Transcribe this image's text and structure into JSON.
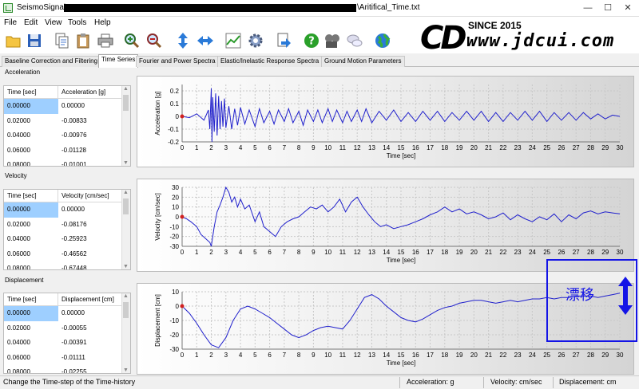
{
  "window": {
    "title": "SeismoSignal",
    "file_name": "\\Aritifical_Time.txt",
    "controls": [
      "—",
      "☐",
      "✕"
    ]
  },
  "menu": [
    "File",
    "Edit",
    "View",
    "Tools",
    "Help"
  ],
  "toolbar_icons": [
    "open-folder-icon",
    "save-icon",
    "copy-icon",
    "clipboard-icon",
    "print-icon",
    "zoom-in-icon",
    "zoom-out-icon",
    "vertical-arrows-icon",
    "horizontal-arrows-icon",
    "chart-icon",
    "gear-icon",
    "export-icon",
    "help-icon",
    "film-icon",
    "chat-icon",
    "globe-icon"
  ],
  "tabs": [
    {
      "label": "Baseline Correction and Filtering",
      "active": false
    },
    {
      "label": "Time Series",
      "active": true
    },
    {
      "label": "Fourier and Power Spectra",
      "active": false
    },
    {
      "label": "Elastic/Inelastic Response Spectra",
      "active": false
    },
    {
      "label": "Ground Motion Parameters",
      "active": false
    }
  ],
  "sections": [
    {
      "label": "Acceleration",
      "columns": [
        "Time [sec]",
        "Acceleration [g]"
      ],
      "rows": [
        [
          "0.00000",
          "0.00000"
        ],
        [
          "0.02000",
          "-0.00833"
        ],
        [
          "0.04000",
          "-0.00976"
        ],
        [
          "0.06000",
          "-0.01128"
        ],
        [
          "0.08000",
          "-0.01001"
        ]
      ]
    },
    {
      "label": "Velocity",
      "columns": [
        "Time [sec]",
        "Velocity [cm/sec]"
      ],
      "rows": [
        [
          "0.00000",
          "0.00000"
        ],
        [
          "0.02000",
          "-0.08176"
        ],
        [
          "0.04000",
          "-0.25923"
        ],
        [
          "0.06000",
          "-0.46562"
        ],
        [
          "0.08000",
          "-0.67448"
        ]
      ]
    },
    {
      "label": "Displacement",
      "columns": [
        "Time [sec]",
        "Displacement [cm]"
      ],
      "rows": [
        [
          "0.00000",
          "0.00000"
        ],
        [
          "0.02000",
          "-0.00055"
        ],
        [
          "0.04000",
          "-0.00391"
        ],
        [
          "0.06000",
          "-0.01111"
        ],
        [
          "0.08000",
          "-0.02255"
        ]
      ]
    }
  ],
  "chart_data": [
    {
      "type": "line",
      "xlabel": "Time [sec]",
      "ylabel": "Acceleration [g]",
      "xlim": [
        0,
        30
      ],
      "ylim": [
        -0.2,
        0.25
      ],
      "xticks": [
        0,
        1,
        2,
        3,
        4,
        5,
        6,
        7,
        8,
        9,
        10,
        11,
        12,
        13,
        14,
        15,
        16,
        17,
        18,
        19,
        20,
        21,
        22,
        23,
        24,
        25,
        26,
        27,
        28,
        29,
        30
      ],
      "yticks": [
        -0.2,
        -0.1,
        0,
        0.1,
        0.2
      ],
      "ytick_labels": [
        "-0.2",
        "-0.1",
        "0",
        "0.1",
        "0.2"
      ],
      "color": "#2020cc",
      "series": [
        {
          "x": [
            0,
            0.5,
            1,
            1.5,
            1.8,
            1.9,
            2,
            2.05,
            2.1,
            2.2,
            2.3,
            2.4,
            2.5,
            2.6,
            2.7,
            2.8,
            2.9,
            3,
            3.2,
            3.4,
            3.6,
            3.8,
            4,
            4.3,
            4.6,
            5,
            5.3,
            5.6,
            6,
            6.3,
            6.6,
            7,
            7.3,
            7.6,
            8,
            8.3,
            8.6,
            9,
            9.3,
            9.6,
            10,
            10.3,
            10.6,
            11,
            11.3,
            11.6,
            12,
            12.3,
            12.6,
            13,
            13.5,
            14,
            14.5,
            15,
            15.5,
            16,
            16.5,
            17,
            17.5,
            18,
            18.5,
            19,
            19.5,
            20,
            20.5,
            21,
            21.5,
            22,
            22.5,
            23,
            23.5,
            24,
            24.5,
            25,
            25.5,
            26,
            26.5,
            27,
            27.5,
            28,
            28.5,
            29,
            29.5,
            30
          ],
          "y": [
            0,
            -0.01,
            0.02,
            -0.03,
            0.05,
            -0.1,
            0.22,
            -0.2,
            0.15,
            -0.12,
            0.18,
            -0.15,
            0.16,
            -0.1,
            0.12,
            -0.08,
            0.14,
            -0.09,
            0.08,
            -0.1,
            0.06,
            -0.07,
            0.07,
            -0.06,
            0.05,
            -0.08,
            0.06,
            -0.05,
            0.04,
            -0.06,
            0.05,
            -0.04,
            0.06,
            -0.05,
            0.04,
            -0.07,
            0.05,
            -0.04,
            0.05,
            -0.05,
            0.06,
            -0.04,
            0.05,
            -0.05,
            0.04,
            -0.04,
            0.05,
            -0.04,
            0.06,
            -0.05,
            0.04,
            -0.03,
            0.05,
            -0.04,
            0.03,
            -0.04,
            0.04,
            -0.03,
            0.04,
            -0.04,
            0.03,
            -0.03,
            0.04,
            -0.03,
            0.04,
            -0.04,
            0.03,
            -0.04,
            0.03,
            -0.03,
            0.04,
            -0.03,
            0.04,
            -0.04,
            0.03,
            -0.03,
            0.03,
            -0.03,
            0.03,
            -0.02,
            0.02,
            -0.02,
            0.01,
            0
          ]
        }
      ]
    },
    {
      "type": "line",
      "xlabel": "Time [sec]",
      "ylabel": "Velocity [cm/sec]",
      "xlim": [
        0,
        30
      ],
      "ylim": [
        -30,
        30
      ],
      "xticks": [
        0,
        1,
        2,
        3,
        4,
        5,
        6,
        7,
        8,
        9,
        10,
        11,
        12,
        13,
        14,
        15,
        16,
        17,
        18,
        19,
        20,
        21,
        22,
        23,
        24,
        25,
        26,
        27,
        28,
        29,
        30
      ],
      "yticks": [
        -30,
        -20,
        -10,
        0,
        10,
        20,
        30
      ],
      "ytick_labels": [
        "-30",
        "-20",
        "-10",
        "0",
        "10",
        "20",
        "30"
      ],
      "color": "#2020cc",
      "series": [
        {
          "x": [
            0,
            0.3,
            0.6,
            1,
            1.3,
            1.6,
            1.9,
            2,
            2.2,
            2.4,
            2.6,
            2.8,
            3,
            3.2,
            3.4,
            3.6,
            3.8,
            4,
            4.3,
            4.6,
            5,
            5.3,
            5.6,
            6,
            6.4,
            6.8,
            7.2,
            7.6,
            8,
            8.4,
            8.8,
            9.2,
            9.6,
            10,
            10.4,
            10.8,
            11.2,
            11.6,
            12,
            12.4,
            12.8,
            13.2,
            13.6,
            14,
            14.5,
            15,
            15.5,
            16,
            16.5,
            17,
            17.5,
            18,
            18.5,
            19,
            19.5,
            20,
            20.5,
            21,
            21.5,
            22,
            22.5,
            23,
            23.5,
            24,
            24.5,
            25,
            25.5,
            26,
            26.5,
            27,
            27.5,
            28,
            28.5,
            29,
            29.5,
            30
          ],
          "y": [
            0,
            -2,
            -5,
            -10,
            -18,
            -22,
            -26,
            -30,
            -10,
            5,
            12,
            20,
            30,
            25,
            15,
            20,
            10,
            18,
            8,
            12,
            -5,
            5,
            -10,
            -15,
            -20,
            -10,
            -5,
            -2,
            0,
            5,
            10,
            8,
            12,
            5,
            10,
            18,
            5,
            15,
            20,
            10,
            2,
            -5,
            -10,
            -8,
            -12,
            -10,
            -8,
            -5,
            -2,
            2,
            5,
            10,
            5,
            8,
            3,
            5,
            2,
            -2,
            0,
            4,
            -3,
            2,
            -2,
            -5,
            0,
            -3,
            3,
            -5,
            2,
            -2,
            4,
            6,
            3,
            5,
            4,
            3
          ]
        }
      ]
    },
    {
      "type": "line",
      "xlabel": "Time [sec]",
      "ylabel": "Displacement [cm]",
      "xlim": [
        0,
        30
      ],
      "ylim": [
        -30,
        10
      ],
      "xticks": [
        0,
        1,
        2,
        3,
        4,
        5,
        6,
        7,
        8,
        9,
        10,
        11,
        12,
        13,
        14,
        15,
        16,
        17,
        18,
        19,
        20,
        21,
        22,
        23,
        24,
        25,
        26,
        27,
        28,
        29,
        30
      ],
      "yticks": [
        -30,
        -20,
        -10,
        0,
        10
      ],
      "ytick_labels": [
        "-30",
        "-20",
        "-10",
        "0",
        "10"
      ],
      "color": "#2020cc",
      "series": [
        {
          "x": [
            0,
            0.5,
            1,
            1.5,
            2,
            2.5,
            3,
            3.5,
            4,
            4.5,
            5,
            5.5,
            6,
            6.5,
            7,
            7.5,
            8,
            8.5,
            9,
            9.5,
            10,
            10.5,
            11,
            11.5,
            12,
            12.5,
            13,
            13.5,
            14,
            14.5,
            15,
            15.5,
            16,
            16.5,
            17,
            17.5,
            18,
            18.5,
            19,
            19.5,
            20,
            20.5,
            21,
            21.5,
            22,
            22.5,
            23,
            23.5,
            24,
            24.5,
            25,
            25.5,
            26,
            26.5,
            27,
            27.5,
            28,
            28.5,
            29,
            29.5,
            30
          ],
          "y": [
            0,
            -5,
            -12,
            -20,
            -27,
            -29,
            -22,
            -10,
            -2,
            0,
            -2,
            -5,
            -8,
            -12,
            -16,
            -20,
            -22,
            -20,
            -17,
            -15,
            -14,
            -15,
            -16,
            -10,
            -2,
            6,
            8,
            5,
            0,
            -4,
            -8,
            -10,
            -11,
            -9,
            -6,
            -3,
            -1,
            0,
            2,
            3,
            4,
            4,
            3,
            2,
            3,
            4,
            3,
            4,
            5,
            5,
            6,
            5,
            6,
            6,
            7,
            7,
            7,
            6,
            7,
            8,
            9
          ]
        }
      ]
    }
  ],
  "status": {
    "hint": "Change the Time-step of the Time-history",
    "acceleration": "Acceleration: g",
    "velocity": "Velocity: cm/sec",
    "displacement": "Displacement: cm"
  },
  "watermark": {
    "since": "SINCE 2015",
    "url": "www.jdcui.com"
  },
  "annotation": {
    "text": "漂移",
    "color": "#1414e6"
  }
}
